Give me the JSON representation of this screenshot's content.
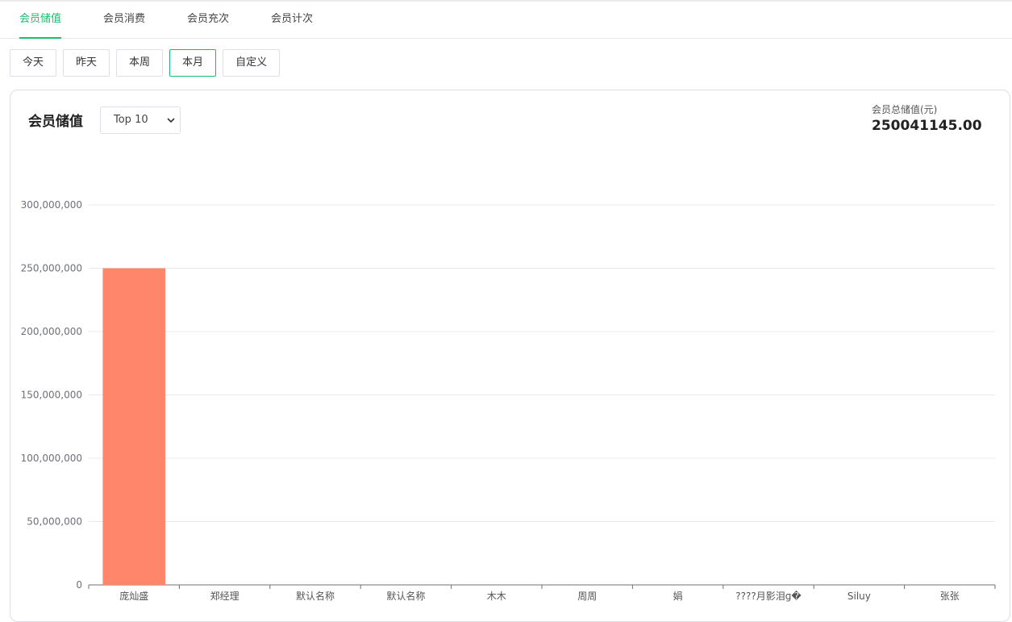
{
  "tabs": [
    "会员储值",
    "会员消费",
    "会员充次",
    "会员计次"
  ],
  "active_tab": 0,
  "ranges": [
    "今天",
    "昨天",
    "本周",
    "本月",
    "自定义"
  ],
  "active_range": 3,
  "card": {
    "title": "会员储值",
    "select_value": "Top 10",
    "total_label": "会员总储值(元)",
    "total_value": "250041145.00"
  },
  "colors": {
    "accent": "#19be6b",
    "bar": "#ff856b",
    "grid": "#e6e9f0",
    "axis": "#6e7079"
  },
  "chart_data": {
    "type": "bar",
    "categories": [
      "庞灿盛",
      "郑经理",
      "默认名称",
      "默认名称",
      "木木",
      "周周",
      "娟",
      "????月影泪ɡ�",
      "Siluy",
      "张张"
    ],
    "values": [
      250000000,
      0,
      0,
      0,
      0,
      0,
      0,
      0,
      0,
      0
    ],
    "ylim": [
      0,
      300000000
    ],
    "yticks": [
      "0",
      "50,000,000",
      "100,000,000",
      "150,000,000",
      "200,000,000",
      "250,000,000",
      "300,000,000"
    ],
    "ytick_values": [
      0,
      50000000,
      100000000,
      150000000,
      200000000,
      250000000,
      300000000
    ],
    "grid": true,
    "legend": "none"
  }
}
